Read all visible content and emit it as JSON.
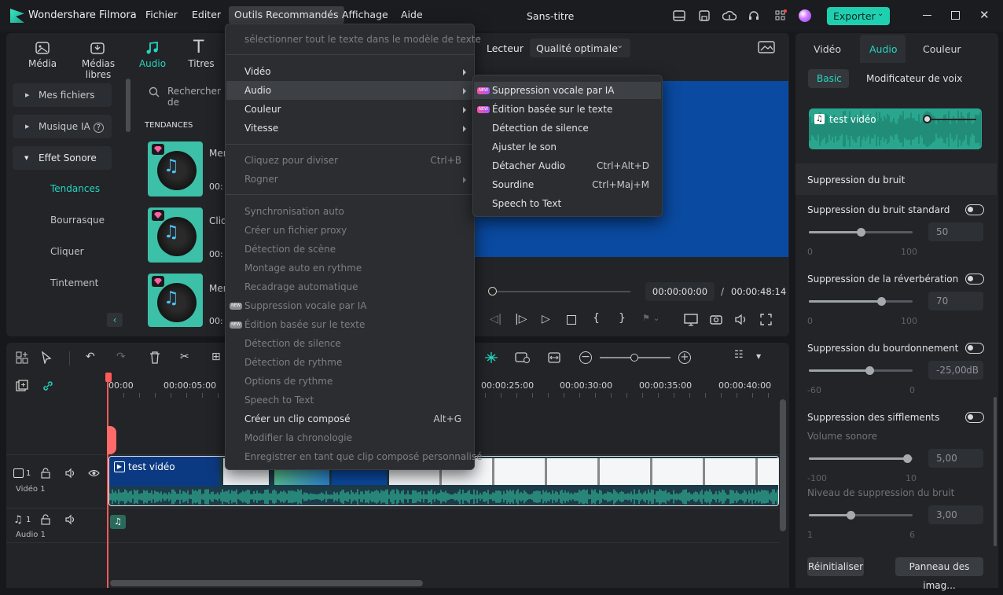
{
  "app": {
    "name": "Wondershare Filmora",
    "project": "Sans-titre",
    "export_label": "Exporter"
  },
  "menubar": [
    "Fichier",
    "Editer",
    "Outils Recommandés",
    "Affichage",
    "Aide"
  ],
  "left_tabs": [
    "Média",
    "Médias libres",
    "Audio",
    "Titres"
  ],
  "sidebar": {
    "items": [
      "Mes fichiers",
      "Musique IA",
      "Effet Sonore"
    ],
    "subitems": [
      "Tendances",
      "Bourrasque",
      "Cliquer",
      "Tintement"
    ]
  },
  "search": {
    "placeholder": "Rechercher de"
  },
  "section_title": "TENDANCES",
  "thumbs": [
    {
      "label": "Mer",
      "time": "00:"
    },
    {
      "label": "Cliq",
      "time": "00:"
    },
    {
      "label": "Mer",
      "time": "00:"
    }
  ],
  "player": {
    "label": "Lecteur",
    "quality": "Qualité optimale",
    "current_time": "00:00:00:00",
    "separator": "/",
    "total_time": "00:00:48:14"
  },
  "tools_menu": {
    "items": [
      {
        "label": "sélectionner tout le texte dans le modèle de texte",
        "disabled": true
      },
      {
        "label": "Vidéo",
        "submenu": true
      },
      {
        "label": "Audio",
        "submenu": true
      },
      {
        "label": "Couleur",
        "submenu": true
      },
      {
        "label": "Vitesse",
        "submenu": true
      },
      {
        "label": "Cliquez pour diviser",
        "shortcut": "Ctrl+B",
        "disabled": true
      },
      {
        "label": "Rogner",
        "submenu": true,
        "disabled": true
      },
      {
        "label": "Synchronisation auto",
        "disabled": true
      },
      {
        "label": "Créer un fichier proxy",
        "disabled": true
      },
      {
        "label": "Détection de scène",
        "disabled": true
      },
      {
        "label": "Montage auto en rythme",
        "disabled": true
      },
      {
        "label": "Recadrage automatique",
        "disabled": true
      },
      {
        "label": "Suppression vocale par IA",
        "disabled": true,
        "badge": "NEW"
      },
      {
        "label": "Édition basée sur le texte",
        "disabled": true,
        "badge": "NEW"
      },
      {
        "label": "Détection de silence",
        "disabled": true
      },
      {
        "label": "Détection de rythme",
        "disabled": true
      },
      {
        "label": "Options de rythme",
        "disabled": true
      },
      {
        "label": "Speech to Text",
        "disabled": true
      },
      {
        "label": "Créer un clip composé",
        "shortcut": "Alt+G"
      },
      {
        "label": "Modifier la chronologie",
        "disabled": true
      },
      {
        "label": "Enregistrer en tant que clip composé personnalisé",
        "disabled": true
      }
    ]
  },
  "audio_submenu": {
    "items": [
      {
        "label": "Suppression vocale par IA",
        "badge": "NEW"
      },
      {
        "label": "Édition basée sur le texte",
        "badge": "NEW"
      },
      {
        "label": "Détection de silence"
      },
      {
        "label": "Ajuster le son"
      },
      {
        "label": "Détacher Audio",
        "shortcut": "Ctrl+Alt+D"
      },
      {
        "label": "Sourdine",
        "shortcut": "Ctrl+Maj+M"
      },
      {
        "label": "Speech to Text"
      }
    ]
  },
  "right_panel": {
    "tabs": [
      "Vidéo",
      "Audio",
      "Couleur"
    ],
    "subtabs": [
      "Basic",
      "Modificateur de voix"
    ],
    "clip_name": "test vidéo",
    "section": "Suppression du bruit",
    "denoise": [
      {
        "label": "Suppression du bruit standard",
        "value": "50",
        "min": "0",
        "max": "100",
        "level": 0.5
      },
      {
        "label": "Suppression de la réverbération",
        "value": "70",
        "min": "0",
        "max": "100",
        "level": 0.7
      },
      {
        "label": "Suppression du bourdonnement",
        "value": "-25,00",
        "unit": "dB",
        "min": "-60",
        "max": "0",
        "level": 0.58
      }
    ],
    "hiss": {
      "label": "Suppression des sifflements",
      "volume_label": "Volume sonore",
      "volume_value": "5,00",
      "volume_min": "-100",
      "volume_max": "10",
      "volume_level": 0.95,
      "noise_label": "Niveau de suppression du bruit",
      "noise_value": "3,00",
      "noise_min": "1",
      "noise_max": "6",
      "noise_level": 0.4
    },
    "reset": "Réinitialiser",
    "image_panel": "Panneau des imag..."
  },
  "timeline": {
    "ruler": [
      "00:00",
      "00:00:05:00",
      "00:00:25:00",
      "00:00:30:00",
      "00:00:35:00",
      "00:00:40:00"
    ],
    "video_track": "Vidéo 1",
    "audio_track": "Audio 1",
    "clip_label": "test vidéo",
    "track_num_video": "1",
    "track_num_audio": "1"
  },
  "colors": {
    "accent": "#1fd0b0",
    "preview_blue": "#0a4aa0",
    "wave": "#2fb89a"
  }
}
